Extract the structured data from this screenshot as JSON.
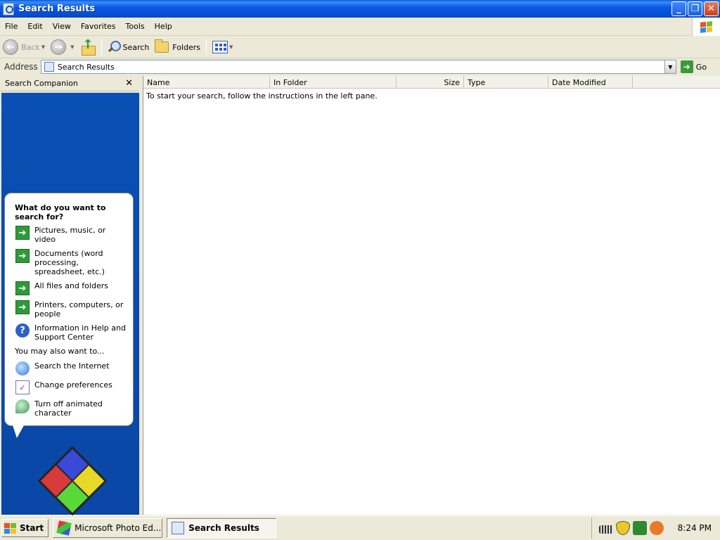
{
  "window": {
    "title": "Search Results",
    "controls": {
      "minimize": "_",
      "restore": "❐",
      "close": "✕"
    }
  },
  "menu": [
    "File",
    "Edit",
    "View",
    "Favorites",
    "Tools",
    "Help"
  ],
  "toolbar": {
    "back_label": "Back",
    "search_label": "Search",
    "folders_label": "Folders"
  },
  "address": {
    "label": "Address",
    "value": "Search Results",
    "go_label": "Go"
  },
  "search_companion": {
    "title": "Search Companion",
    "close": "✕",
    "question": "What do you want to search for?",
    "options": [
      {
        "label": "Pictures, music, or video",
        "icon": "green-arrow-icon"
      },
      {
        "label": "Documents (word processing, spreadsheet, etc.)",
        "icon": "green-arrow-icon"
      },
      {
        "label": "All files and folders",
        "icon": "green-arrow-icon"
      },
      {
        "label": "Printers, computers, or people",
        "icon": "green-arrow-icon"
      },
      {
        "label": "Information in Help and Support Center",
        "icon": "help-icon"
      }
    ],
    "also_label": "You may also want to...",
    "also_options": [
      {
        "label": "Search the Internet",
        "icon": "internet-search-icon"
      },
      {
        "label": "Change preferences",
        "icon": "preferences-icon"
      },
      {
        "label": "Turn off animated character",
        "icon": "animated-character-icon"
      }
    ]
  },
  "results": {
    "columns": [
      "Name",
      "In Folder",
      "Size",
      "Type",
      "Date Modified"
    ],
    "message": "To start your search, follow the instructions in the left pane."
  },
  "taskbar": {
    "start_label": "Start",
    "tasks": [
      {
        "label": "Microsoft Photo Ed...",
        "active": false
      },
      {
        "label": "Search Results",
        "active": true
      }
    ],
    "clock": "8:24 PM"
  },
  "colors": {
    "titlebar": "#0a5ae6",
    "companion_background": "#0a4fb5",
    "arrow_green": "#2f9a3a"
  }
}
